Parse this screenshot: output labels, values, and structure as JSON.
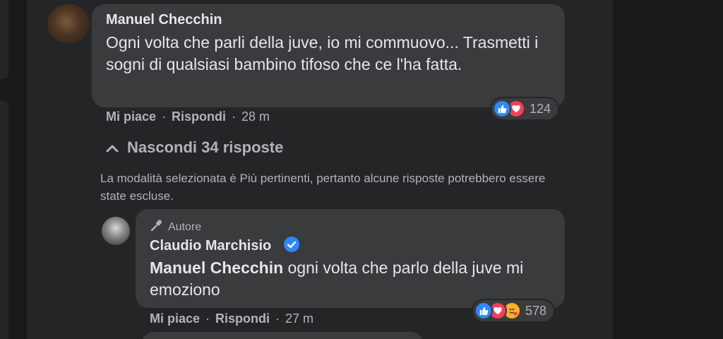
{
  "comment": {
    "author": "Manuel Checchin",
    "text": "Ogni volta che parli della juve, io mi commuovo... Trasmetti i sogni di qualsiasi bambino tifoso che ce l'ha fatta.",
    "actions": {
      "like": "Mi piace",
      "reply": "Rispondi",
      "separator": "·",
      "time": "28 m"
    },
    "reactions": {
      "icons": [
        "like-icon",
        "love-icon"
      ],
      "count": "124"
    }
  },
  "replies_toggle": {
    "icon": "chevron-up-icon",
    "label": "Nascondi 34 risposte"
  },
  "notice": "La modalità selezionata è Più pertinenti, pertanto alcune risposte potrebbero essere state escluse.",
  "reply": {
    "badge": {
      "icon": "microphone-icon",
      "label": "Autore"
    },
    "author": "Claudio Marchisio",
    "verified_icon": "verified-check-icon",
    "mention": "Manuel Checchin",
    "text": " ogni volta che parlo della juve mi emoziono",
    "actions": {
      "like": "Mi piace",
      "reply": "Rispondi",
      "separator": "·",
      "time": "27 m"
    },
    "reactions": {
      "icons": [
        "like-icon",
        "love-icon",
        "care-icon"
      ],
      "count": "578"
    }
  },
  "colors": {
    "background": "#18191a",
    "panel": "#242526",
    "bubble": "#3a3b3c",
    "text_primary": "#e4e6eb",
    "text_secondary": "#b0b3b8",
    "like_blue": "#2d88ff",
    "love_red": "#f33e58",
    "care_yellow": "#f7b125"
  }
}
